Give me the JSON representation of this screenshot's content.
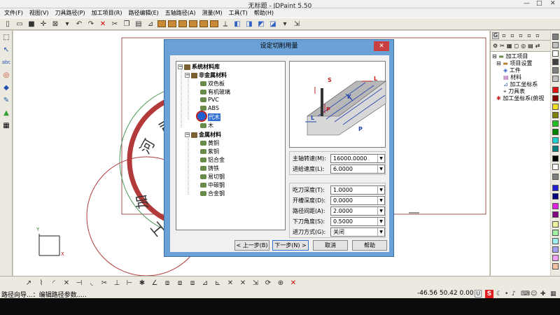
{
  "window": {
    "title": "无标题 - JDPaint 5.50",
    "minimize": "—",
    "maximize": "□",
    "close": "✕"
  },
  "menu": [
    "文件(F)",
    "视图(V)",
    "刀具路径(P)",
    "加工项目(R)",
    "路径编辑(E)",
    "五轴路径(A)",
    "测量(M)",
    "工具(T)",
    "帮助(H)"
  ],
  "canvas": {
    "stamp_text_1": "司",
    "stamp_text_2": "河",
    "stamp_text_3": "加",
    "stamp_text_4": "工",
    "axis_y": "Y",
    "axis_x": "X"
  },
  "dialog": {
    "title": "设定切削用量",
    "close": "✕",
    "tree": {
      "root": "系统材料库",
      "group1": "非金属材料",
      "group1_items": [
        "双色板",
        "有机玻璃",
        "PVC",
        "ABS",
        "代木",
        "木"
      ],
      "group2": "金属材料",
      "group2_items": [
        "黄铜",
        "紫铜",
        "铝合金",
        "铸铁",
        "易切钢",
        "中碳钢",
        "合金钢"
      ]
    },
    "preview_labels": {
      "s": "S",
      "l": "L",
      "k": "K",
      "p": "P",
      "l2": "L",
      "p2": "P"
    },
    "params1": [
      {
        "label": "主轴转速(M):",
        "value": "16000.0000"
      },
      {
        "label": "进给速度(L):",
        "value": "6.0000"
      }
    ],
    "params2": [
      {
        "label": "吃刀深度(T):",
        "value": "1.0000"
      },
      {
        "label": "开槽深度(D):",
        "value": "0.0000"
      },
      {
        "label": "路径间距(A):",
        "value": "2.0000"
      },
      {
        "label": "下刀角度(S):",
        "value": "0.5000"
      },
      {
        "label": "进刀方式(G):",
        "value": "关闭"
      }
    ],
    "buttons": {
      "back": "< 上一步(B)",
      "next": "下一步(N) >",
      "cancel": "取消",
      "help": "帮助"
    }
  },
  "right_panel": {
    "tab_label": "G",
    "tree": [
      "加工项目",
      "项目设置",
      "工件",
      "材料",
      "加工坐标系",
      "刀具表",
      "加工坐标系(俯视"
    ]
  },
  "status": {
    "message": "路径向导...：编辑路径参数.....",
    "coords": "-46.56 50.42 0.00",
    "unit_mode": "U",
    "ime": "S"
  },
  "colors": {
    "dialog_frame": "#6aa1d6",
    "selection": "#3070d0",
    "stamp_red": "#b23a3a",
    "stamp_green": "#4c9a5a",
    "delete_red": "#cc0000"
  }
}
